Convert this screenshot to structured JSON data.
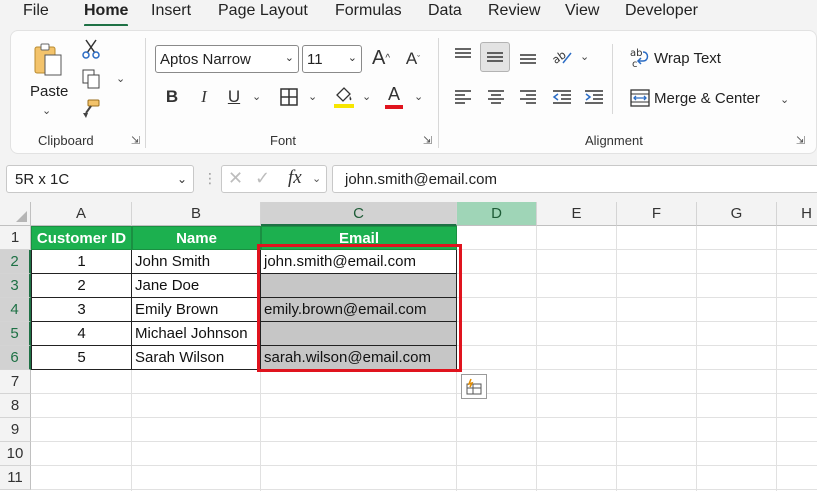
{
  "menu": {
    "tabs": [
      "File",
      "Home",
      "Insert",
      "Page Layout",
      "Formulas",
      "Data",
      "Review",
      "View",
      "Developer"
    ],
    "active": "Home"
  },
  "ribbon": {
    "clipboard": {
      "label": "Clipboard",
      "paste_label": "Paste"
    },
    "font": {
      "label": "Font",
      "font_name": "Aptos Narrow",
      "font_size": "11",
      "bold": "B",
      "italic": "I",
      "underline": "U"
    },
    "alignment": {
      "label": "Alignment",
      "wrap_text": "Wrap Text",
      "merge_center": "Merge & Center"
    }
  },
  "formula_bar": {
    "name_box": "5R x 1C",
    "fx_label": "fx",
    "content": "john.smith@email.com"
  },
  "grid": {
    "columns": [
      "A",
      "B",
      "C",
      "D",
      "E",
      "F",
      "G",
      "H"
    ],
    "rows": [
      "1",
      "2",
      "3",
      "4",
      "5",
      "6",
      "7",
      "8",
      "9",
      "10",
      "11"
    ],
    "header_row": [
      "Customer ID",
      "Name",
      "Email"
    ],
    "data_rows": [
      [
        "1",
        "John Smith",
        "john.smith@email.com"
      ],
      [
        "2",
        "Jane Doe",
        ""
      ],
      [
        "3",
        "Emily Brown",
        "emily.brown@email.com"
      ],
      [
        "4",
        "Michael Johnson",
        ""
      ],
      [
        "5",
        "Sarah Wilson",
        "sarah.wilson@email.com"
      ]
    ]
  },
  "colors": {
    "accent": "#1e7145",
    "header_fill": "#1cb04f",
    "selection_outline": "#e0141e",
    "selection_fill": "#c6c6c6"
  },
  "icons": [
    "paste-icon",
    "cut-icon",
    "copy-icon",
    "format-painter-icon",
    "increase-font-icon",
    "decrease-font-icon",
    "borders-icon",
    "fill-color-icon",
    "font-color-icon",
    "align-top-icon",
    "align-middle-icon",
    "align-bottom-icon",
    "orientation-icon",
    "align-left-icon",
    "align-center-icon",
    "align-right-icon",
    "decrease-indent-icon",
    "increase-indent-icon",
    "wrap-text-icon",
    "merge-center-icon",
    "cancel-icon",
    "enter-icon",
    "quick-analysis-icon"
  ]
}
